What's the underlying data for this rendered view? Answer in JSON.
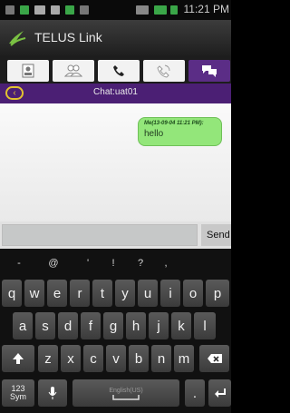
{
  "status": {
    "time": "11:21 PM"
  },
  "app": {
    "title": "TELUS Link"
  },
  "tabs": [
    {
      "name": "contacts-card",
      "active": false
    },
    {
      "name": "group",
      "active": false
    },
    {
      "name": "call",
      "active": false
    },
    {
      "name": "call-log",
      "active": false
    },
    {
      "name": "chat",
      "active": true
    }
  ],
  "chat": {
    "title": "Chat:uat01",
    "messages": [
      {
        "meta": "Me(13-09-04 11:21 PM):",
        "text": "hello"
      }
    ],
    "input_value": "",
    "send_label": "Send"
  },
  "keyboard": {
    "symbols": [
      "-",
      "@",
      "'",
      "!",
      "?",
      ","
    ],
    "row1": [
      "q",
      "w",
      "e",
      "r",
      "t",
      "y",
      "u",
      "i",
      "o",
      "p"
    ],
    "row2": [
      "a",
      "s",
      "d",
      "f",
      "g",
      "h",
      "j",
      "k",
      "l"
    ],
    "row3": [
      "z",
      "x",
      "c",
      "v",
      "b",
      "n",
      "m"
    ],
    "sym_label_top": "123",
    "sym_label_bottom": "Sym",
    "space_label": "English(US)",
    "period": "."
  },
  "colors": {
    "header_purple": "#4b1f74",
    "tab_active": "#5b2d86",
    "bubble": "#93e67a"
  }
}
